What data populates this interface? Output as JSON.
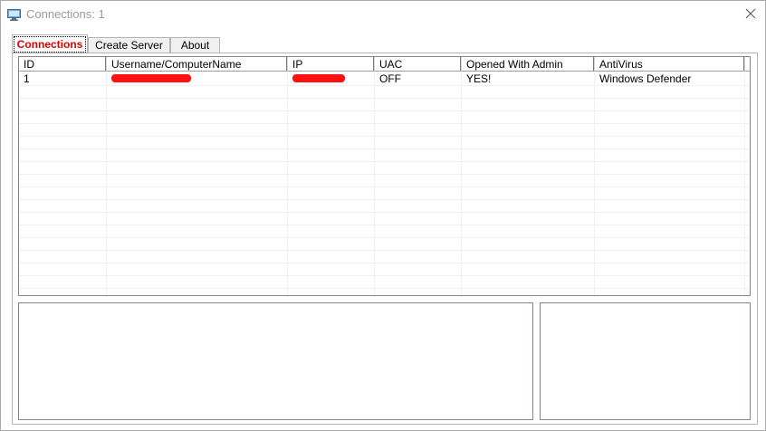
{
  "window": {
    "title": "Connections: 1"
  },
  "tabs": [
    {
      "label": "Connections"
    },
    {
      "label": "Create Server"
    },
    {
      "label": "About"
    }
  ],
  "table": {
    "columns": [
      "ID",
      "Username/ComputerName",
      "IP",
      "UAC",
      "Opened With Admin",
      "AntiVirus"
    ],
    "rows": [
      {
        "id": "1",
        "username": "[redacted]",
        "ip": "[redacted]",
        "uac": "OFF",
        "admin": "YES!",
        "antivirus": "Windows Defender"
      }
    ]
  },
  "colors": {
    "active_tab_text": "#e00000",
    "redaction": "#ff1111"
  },
  "icons": {
    "app": "computer-monitor-icon",
    "close": "close-icon"
  }
}
